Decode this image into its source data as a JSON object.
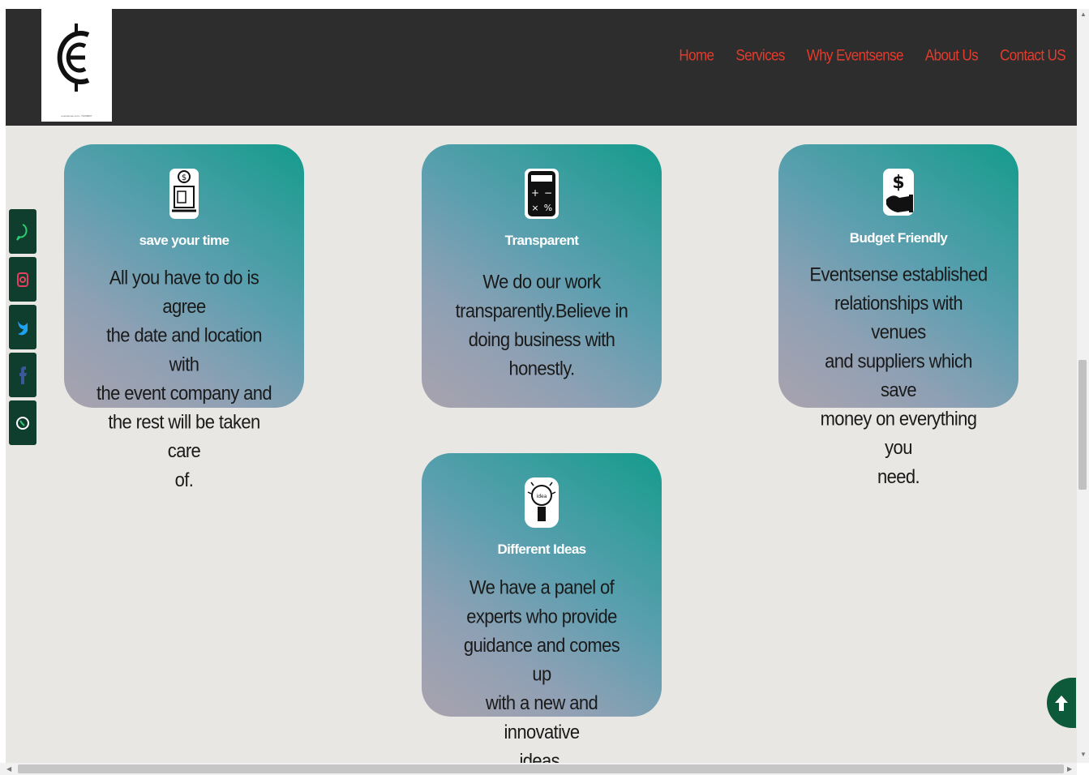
{
  "header": {
    "logo_caption": "eventsense.com • 74299867",
    "nav": [
      "Home",
      "Services",
      "Why Eventsense",
      "About Us",
      "Contact US"
    ]
  },
  "cards": [
    {
      "icon": "laptop-money-icon",
      "title": "save your time",
      "lines": [
        "All you have to do is agree",
        "the date and location with",
        "the event company and",
        "the rest will be taken care",
        "of."
      ]
    },
    {
      "icon": "calculator-icon",
      "title": "Transparent",
      "lines": [
        "We do our work",
        "transparently.Believe in",
        "doing business with",
        "honestly."
      ]
    },
    {
      "icon": "hand-dollar-icon",
      "title": "Budget Friendly",
      "lines": [
        "Eventsense established",
        "relationships with venues",
        "and suppliers which save",
        "money on everything you",
        "need."
      ]
    },
    {
      "icon": "lightbulb-icon",
      "title": "Different Ideas",
      "lines": [
        "We have a panel of",
        "experts who provide",
        "guidance and comes up",
        "with a new and innovative",
        "ideas."
      ]
    }
  ],
  "social": [
    "whatsapp-icon",
    "instagram-icon",
    "twitter-icon",
    "facebook-icon",
    "phone-icon"
  ],
  "colors": {
    "nav_link": "#e53b2c",
    "header_bg": "#2d2d2d",
    "page_bg": "#e9e7e3",
    "social_bg": "#0f3d2e",
    "scroll_top_bg": "#0d5a3a"
  }
}
